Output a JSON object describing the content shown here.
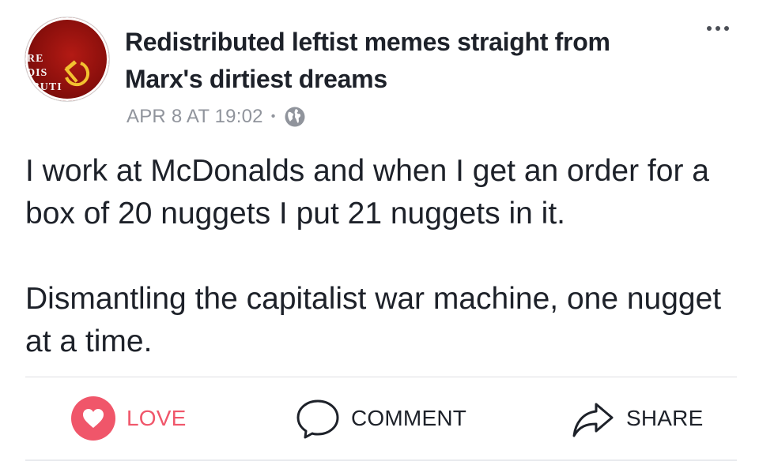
{
  "post": {
    "author": "Redistributed leftist memes straight from Marx's dirtiest dreams",
    "timestamp": "APR 8 AT 19:02",
    "separator": "•",
    "privacy_icon": "globe-icon",
    "avatar_text": [
      "RE",
      "DIS",
      "IBUTI"
    ],
    "body_paragraphs": [
      "I work at McDonalds and when I get an order for a box of 20 nuggets I put 21 nuggets in it.",
      "Dismantling the capitalist war machine, one nugget at a time."
    ]
  },
  "actions": {
    "love_label": "LOVE",
    "comment_label": "COMMENT",
    "share_label": "SHARE"
  },
  "colors": {
    "love": "#f0566a",
    "meta": "#90949c",
    "text": "#1d2129",
    "avatar_red": "#b31a14"
  },
  "icons": {
    "more": "more-options-icon",
    "love": "heart-icon",
    "comment": "speech-bubble-icon",
    "share": "share-arrow-icon"
  }
}
